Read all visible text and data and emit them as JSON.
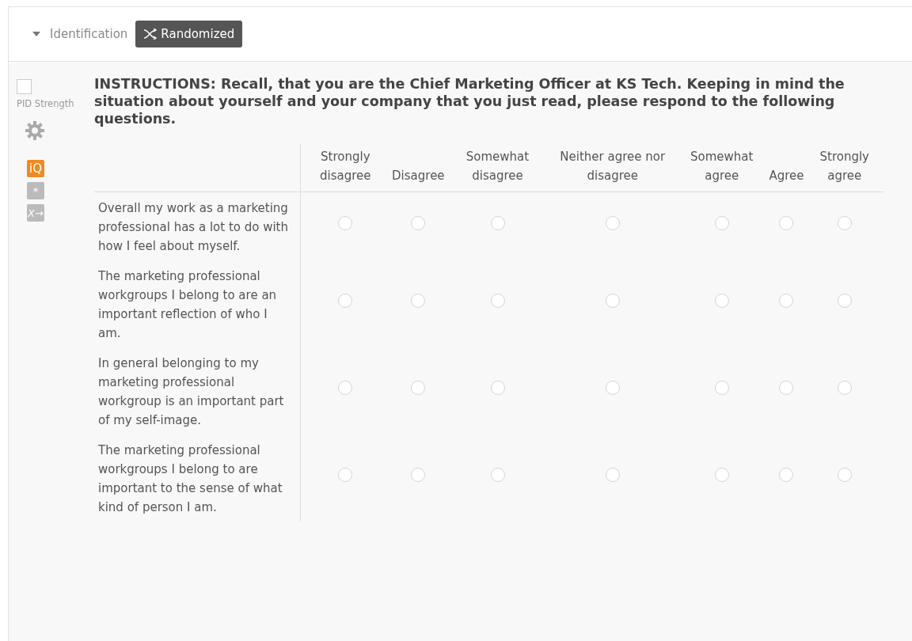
{
  "block": {
    "title": "Identification",
    "expanded": true,
    "badge": "Randomized"
  },
  "sidebar": {
    "checkbox": {
      "label": "PID Strength",
      "checked": false
    },
    "tools": [
      {
        "kind": "gear"
      },
      {
        "kind": "iq",
        "label": "iQ",
        "active": true
      },
      {
        "kind": "asterisk",
        "label": "*",
        "active": false
      },
      {
        "kind": "xarrow",
        "label": "X→",
        "active": false
      }
    ]
  },
  "question": {
    "text": "INSTRUCTIONS: Recall, that you are the Chief Marketing Officer at KS Tech. Keeping in mind the situation about yourself and your company that you just read, please respond to the following questions.",
    "columns": [
      "Strongly disagree",
      "Disagree",
      "Somewhat disagree",
      "Neither agree nor disagree",
      "Somewhat agree",
      "Agree",
      "Strongly agree"
    ],
    "rows": [
      {
        "statement": "Overall my work as a marketing professional has a lot to do with how I feel about myself.",
        "choices": [
          {
            "selected": false
          },
          {
            "selected": false
          },
          {
            "selected": false
          },
          {
            "selected": false
          },
          {
            "selected": false
          },
          {
            "selected": false
          },
          {
            "selected": false
          }
        ]
      },
      {
        "statement": "The marketing professional workgroups I belong to are an important reflection of who I am.",
        "choices": [
          {
            "selected": false
          },
          {
            "selected": false
          },
          {
            "selected": false
          },
          {
            "selected": false
          },
          {
            "selected": false
          },
          {
            "selected": false
          },
          {
            "selected": false
          }
        ]
      },
      {
        "statement": "In general belonging to my marketing professional workgroup is an important part of my self-image.",
        "choices": [
          {
            "selected": false
          },
          {
            "selected": false
          },
          {
            "selected": false
          },
          {
            "selected": false
          },
          {
            "selected": false
          },
          {
            "selected": false
          },
          {
            "selected": false
          }
        ]
      },
      {
        "statement": "The marketing professional workgroups I belong to are important to the sense of what kind of person I am.",
        "choices": [
          {
            "selected": false
          },
          {
            "selected": false
          },
          {
            "selected": false
          },
          {
            "selected": false
          },
          {
            "selected": false
          },
          {
            "selected": false
          },
          {
            "selected": false
          }
        ]
      }
    ]
  }
}
